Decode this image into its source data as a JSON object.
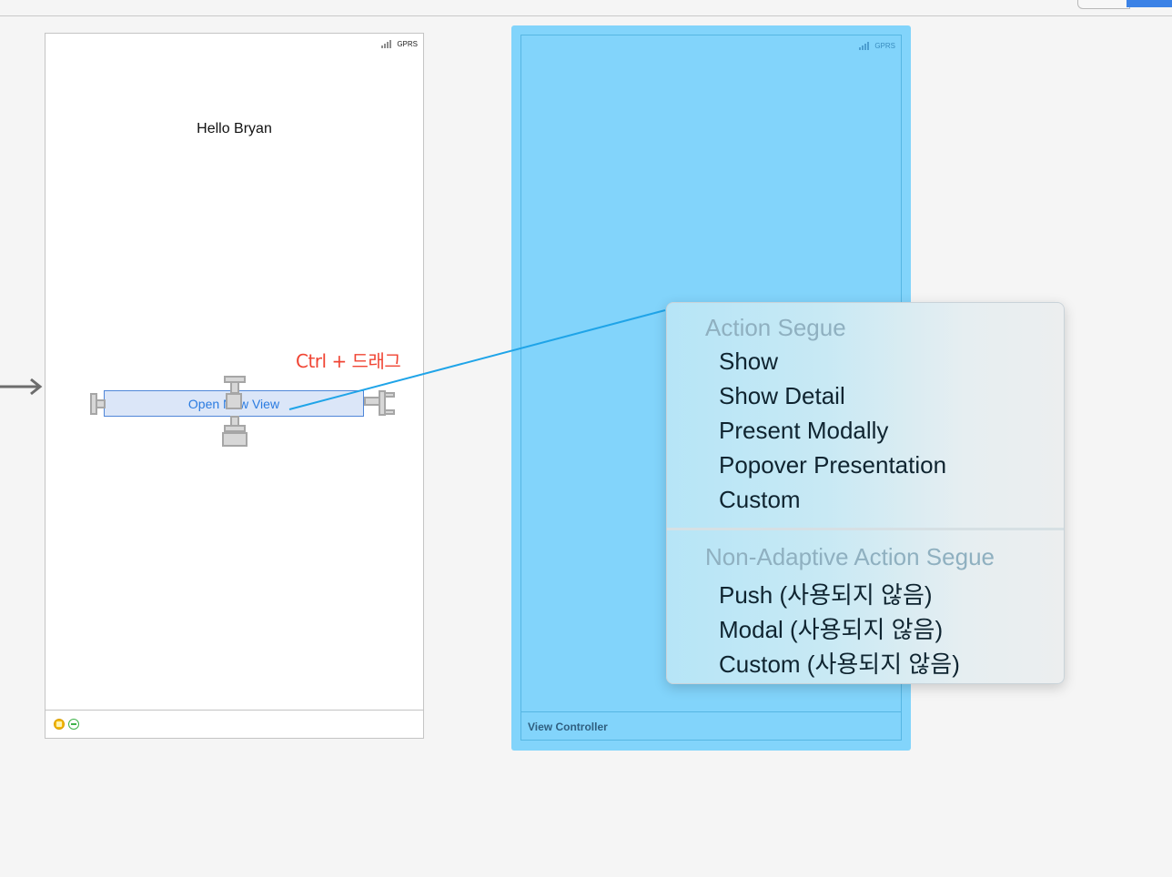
{
  "storyboard": {
    "scene1": {
      "carrier": "GPRS",
      "label_text": "Hello Bryan",
      "button_text": "Open New View"
    },
    "scene2": {
      "carrier": "GPRS",
      "dock_title": "View Controller"
    },
    "annotation": "Ctrl + 드래그"
  },
  "segue_menu": {
    "sections": [
      {
        "header": "Action Segue",
        "items": [
          "Show",
          "Show Detail",
          "Present Modally",
          "Popover Presentation",
          "Custom"
        ]
      },
      {
        "header": "Non-Adaptive Action Segue",
        "items": [
          "Push (사용되지 않음)",
          "Modal (사용되지 않음)",
          "Custom (사용되지 않음)"
        ]
      }
    ]
  },
  "colors": {
    "annotation": "#f04433",
    "connection_line": "#1fa4e8",
    "selected_scene": "#82d4fb",
    "button_text": "#2a7be0"
  },
  "icons": {
    "scene1_dock": [
      "view-controller-icon",
      "exit-icon"
    ],
    "entry": "entry-point-arrow-icon",
    "status": "signal-bars-icon"
  }
}
